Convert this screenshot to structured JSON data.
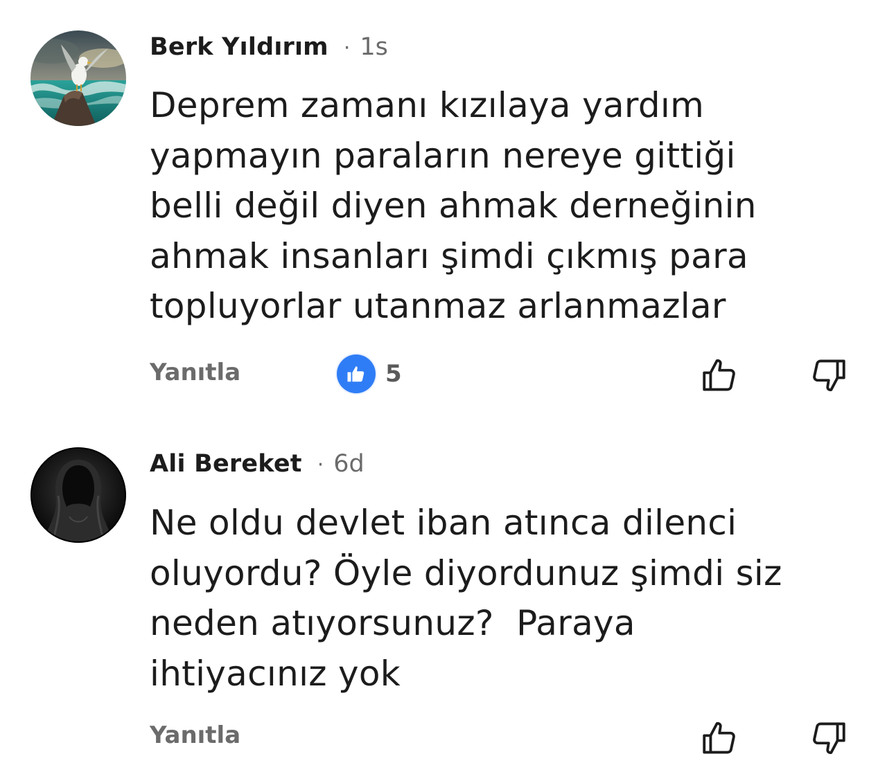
{
  "comments": [
    {
      "author": "Berk Yıldırım",
      "separator": "·",
      "time": "1s",
      "text": "Deprem zamanı kızılaya yardım\nyapmayın paraların nereye gittiği\nbelli değil diyen ahmak derneğinin\nahmak insanları şimdi çıkmış para\ntopluyorlar utanmaz arlanmazlar",
      "reply_label": "Yanıtla",
      "like_count": "5",
      "avatar_icon": "seagull-on-rock-avatar"
    },
    {
      "author": "Ali Bereket",
      "separator": "·",
      "time": "6d",
      "text": "Ne oldu devlet iban atınca dilenci\noluyordu? Öyle diyordunuz şimdi siz\nneden atıyorsunuz?  Paraya\nihtiyacınız yok",
      "reply_label": "Yanıtla",
      "avatar_icon": "hooded-figure-avatar"
    }
  ],
  "colors": {
    "text": "#1c1c1c",
    "muted": "#6b6b6b",
    "like_blue": "#2f7df6"
  }
}
